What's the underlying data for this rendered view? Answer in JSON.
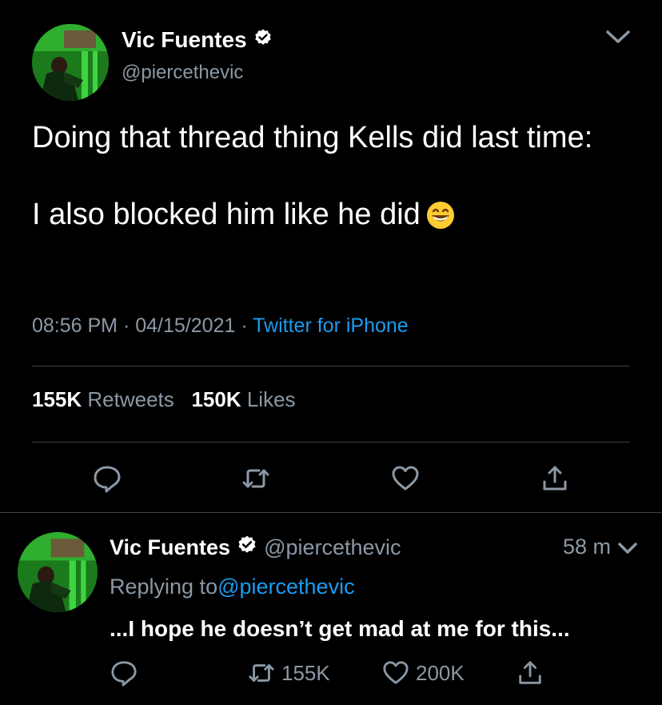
{
  "main_tweet": {
    "author_name": "Vic Fuentes",
    "handle": "@piercethevic",
    "text_line1": "Doing that thread thing Kells did last time:",
    "text_line2": "I also blocked him like he did",
    "text_emoji": "grinning-face-with-smiling-eyes",
    "time": "08:56 PM",
    "separator": "·",
    "date": "04/15/2021",
    "source": "Twitter for iPhone",
    "retweets_count": "155K",
    "retweets_label": "Retweets",
    "likes_count": "150K",
    "likes_label": "Likes"
  },
  "reply_tweet": {
    "author_name": "Vic Fuentes",
    "handle": "@piercethevic",
    "time_ago": "58 m",
    "replying_prefix": "Replying to",
    "replying_handle": "@piercethevic",
    "text": "...I hope he doesn’t get mad at me for this...",
    "retweets": "155K",
    "likes": "200K"
  },
  "icons": {
    "reply": "reply-icon",
    "retweet": "retweet-icon",
    "like": "heart-icon",
    "share": "share-icon",
    "menu": "chevron-down-icon",
    "verified": "verified-badge-icon"
  },
  "colors": {
    "background": "#000000",
    "text_primary": "#ffffff",
    "text_secondary": "#8b98a5",
    "link": "#1d9bf0",
    "divider": "#38444d"
  }
}
